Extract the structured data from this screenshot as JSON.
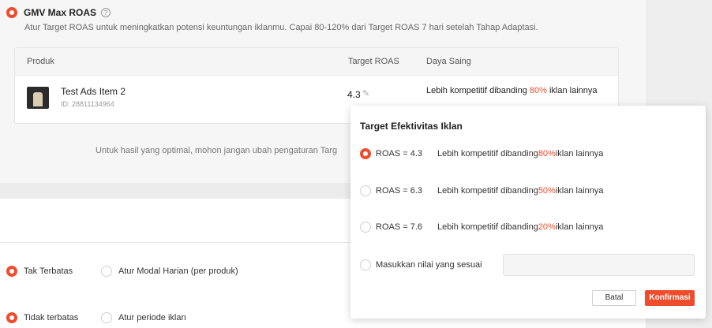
{
  "header": {
    "title": "GMV Max ROAS",
    "description": "Atur Target ROAS untuk meningkatkan potensi keuntungan iklanmu. Capai 80-120% dari Target ROAS 7 hari setelah Tahap Adaptasi."
  },
  "table": {
    "columns": [
      "Produk",
      "Target ROAS",
      "Daya Saing"
    ],
    "rows": [
      {
        "name": "Test Ads Item 2",
        "id": "ID: 28811134964",
        "target_roas": "4.3",
        "daya_pre": "Lebih kompetitif dibanding ",
        "daya_pct": "80%",
        "daya_post": " iklan lainnya"
      }
    ]
  },
  "note": "Untuk hasil yang optimal, mohon jangan ubah pengaturan Targ",
  "budget": {
    "option1": "Tak Terbatas",
    "option2": "Atur Modal Harian (per produk)"
  },
  "period": {
    "option1": "Tidak terbatas",
    "option2": "Atur periode iklan"
  },
  "popup": {
    "title": "Target Efektivitas Iklan",
    "options": [
      {
        "roas": "ROAS = 4.3",
        "pre": "Lebih kompetitif dibanding ",
        "pct": "80%",
        "post": " iklan lainnya",
        "selected": true
      },
      {
        "roas": "ROAS = 6.3",
        "pre": "Lebih kompetitif dibanding ",
        "pct": "50%",
        "post": " iklan lainnya",
        "selected": false
      },
      {
        "roas": "ROAS = 7.6",
        "pre": "Lebih kompetitif dibanding ",
        "pct": "20%",
        "post": " iklan lainnya",
        "selected": false
      }
    ],
    "custom_label": "Masukkan nilai yang sesuai",
    "custom_value": "",
    "cancel_label": "Batal",
    "confirm_label": "Konfirmasi"
  },
  "colors": {
    "accent": "#ee4d2d"
  }
}
